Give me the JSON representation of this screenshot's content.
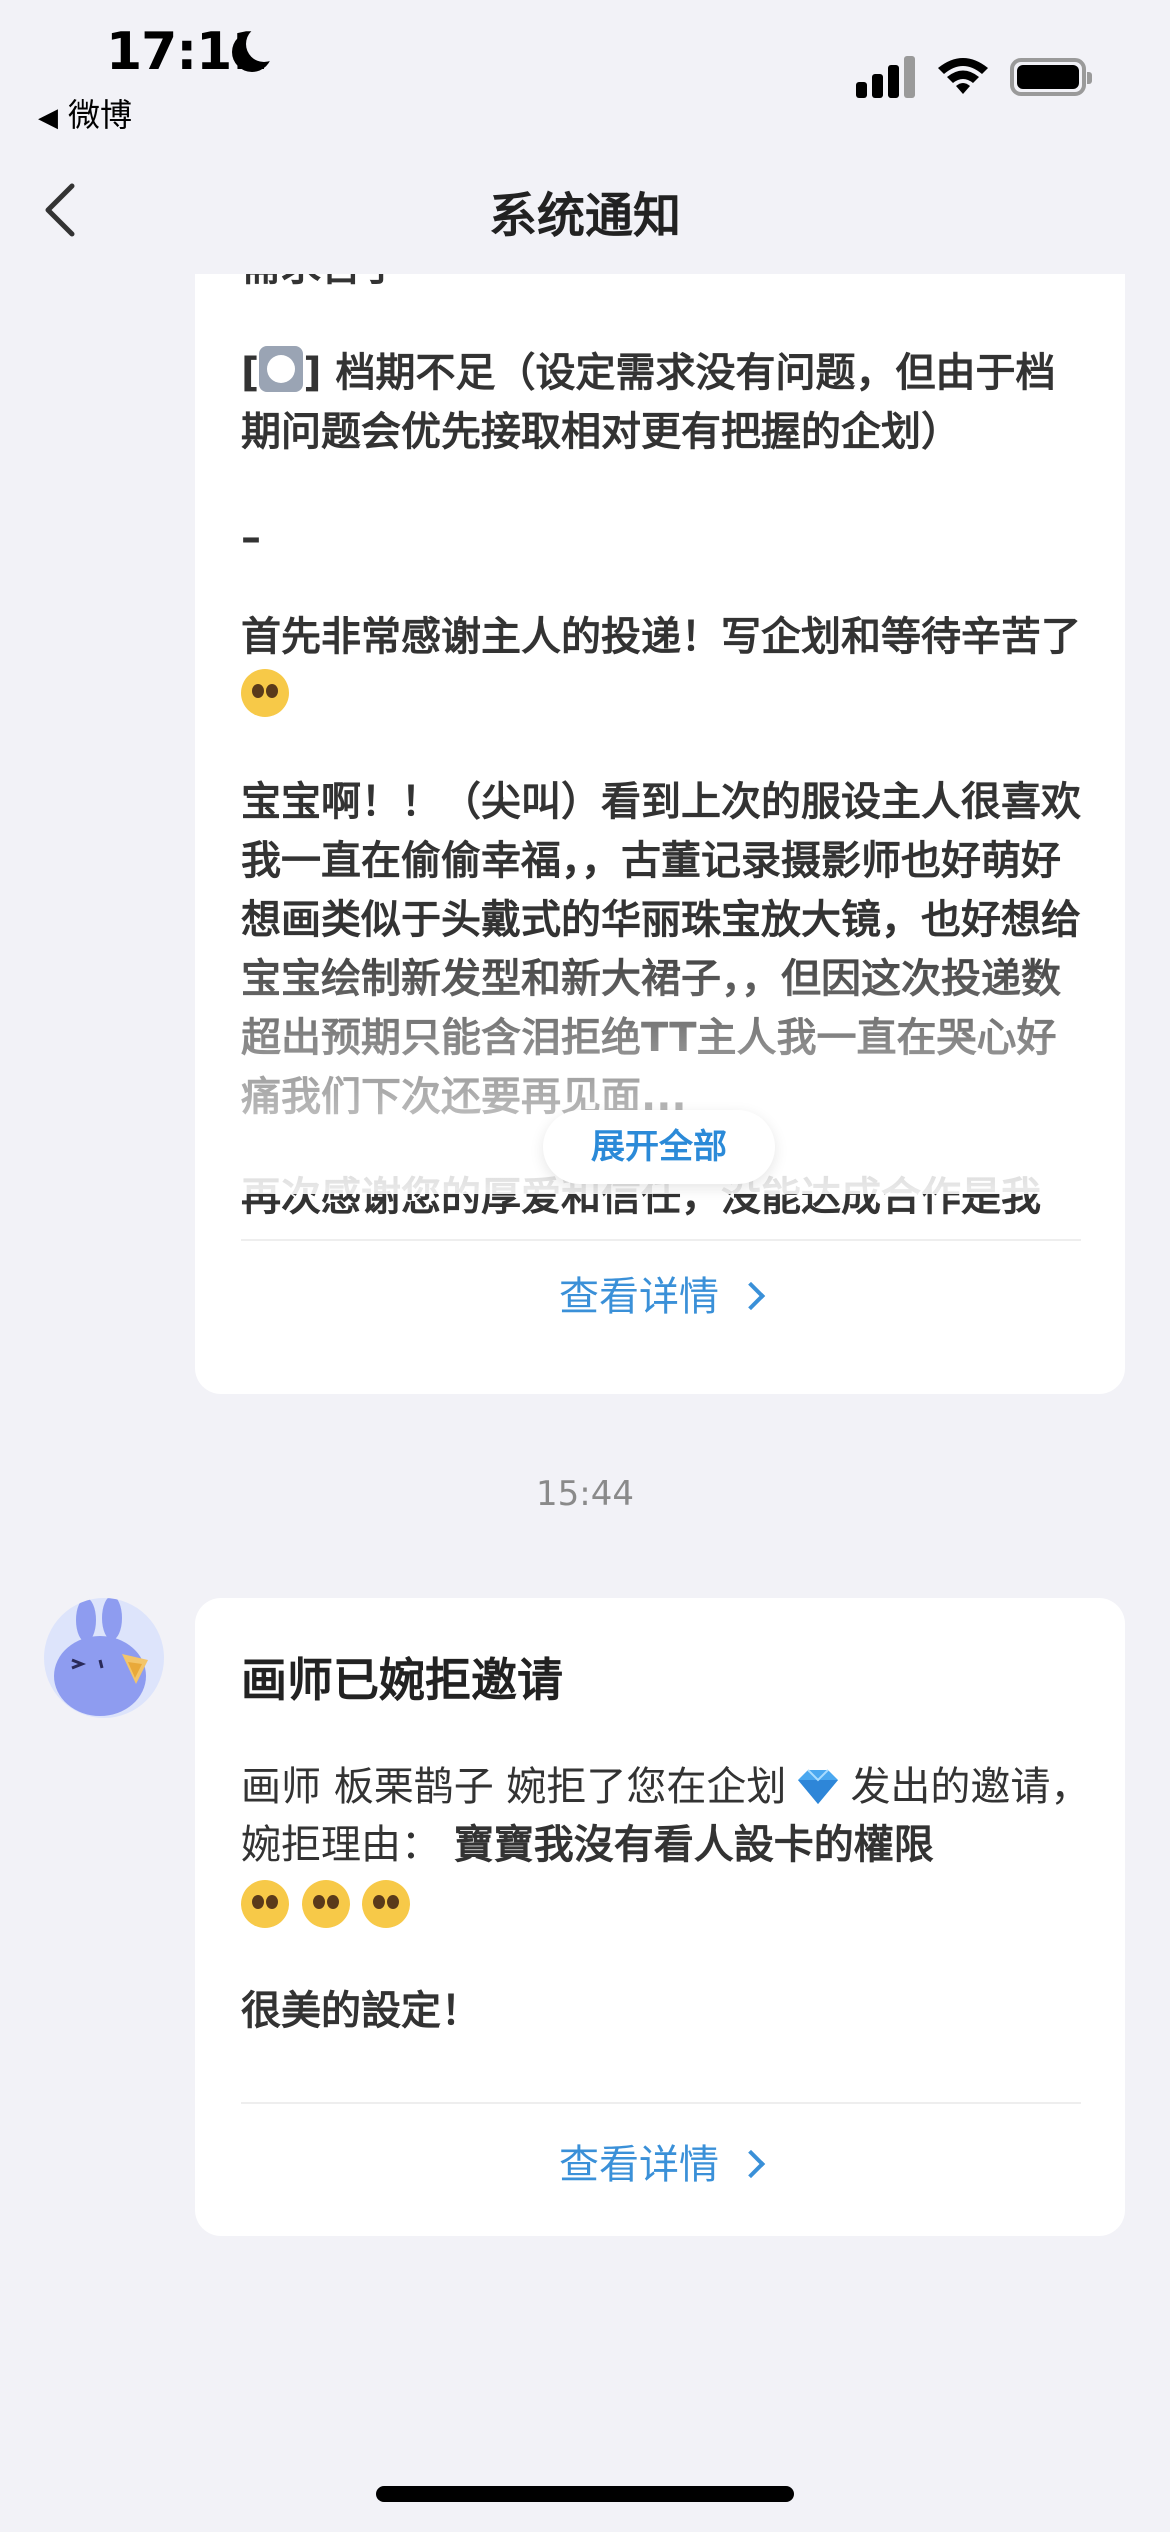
{
  "status_bar": {
    "time": "17:11",
    "back_app": "微博",
    "signal_icon": "cellular-signal-icon",
    "wifi_icon": "wifi-icon",
    "battery_icon": "battery-icon"
  },
  "nav": {
    "title": "系统通知",
    "back_icon": "chevron-left-icon"
  },
  "notice1": {
    "line_top": "需求苦手",
    "checkbox_item": "档期不足（设定需求没有问题，但由于档期问题会优先接取相对更有把握的企划）",
    "bracket_open": "[",
    "bracket_close": "]",
    "dash": "–",
    "thanks": "首先非常感谢主人的投递！写企划和等待辛苦了",
    "long_text": "宝宝啊！！（尖叫）看到上次的服设主人很喜欢我一直在偷偷幸福，，古董记录摄影师也好萌好想画类似于头戴式的华丽珠宝放大镜，也好想给宝宝绘制新发型和新大裙子，，但因这次投递数超出预期只能含泪拒绝TT主人我一直在哭心好痛我们下次还要再见面...",
    "faded_text": "再次感谢您的厚爱和信任，没能达成合作是我",
    "expand_label": "展开全部",
    "detail_label": "查看详情"
  },
  "timestamp": "15:44",
  "notice2": {
    "title": "画师已婉拒邀请",
    "text_prefix": "画师 板栗鹊子 婉拒了您在企划",
    "text_suffix": "发出的邀请，婉拒理由：",
    "reason": "寶寶我沒有看人設卡的權限",
    "extra": "很美的設定！",
    "detail_label": "查看详情",
    "avatar_icon": "rabbit-avatar-icon",
    "diamond_icon": "diamond-icon"
  },
  "colors": {
    "accent": "#3a90d8",
    "background": "#f2f2f7",
    "card": "#ffffff"
  }
}
